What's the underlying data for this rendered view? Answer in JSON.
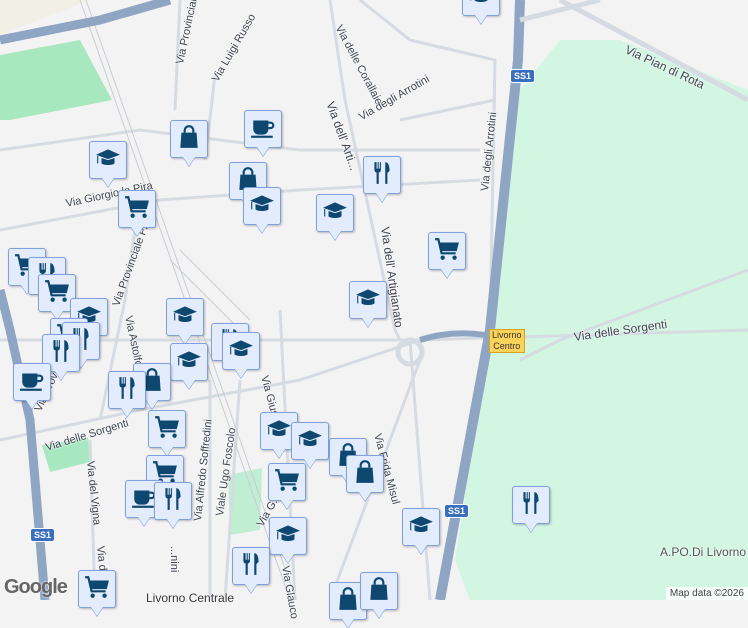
{
  "streets": {
    "provinciale_top": "Via Provinciale",
    "luigi_russo": "Via Luigi Russo",
    "corallaie": "Via delle Corallaie",
    "arrotini": "Via degli Arrotini",
    "arrotini2": "Via degli Arrotini",
    "artigianato_top": "Via dell' Arti...",
    "artigianato": "Via dell' Artigianato",
    "giorgio_la_pira": "Via Giorgio la Pira",
    "provinciale_pisana": "Via Provinciale P...",
    "astolfo": "Via Astolfo L...",
    "provinciale_left": "Via Provi...",
    "sorgenti_left": "Via delle Sorgenti",
    "sorgenti_right": "Via delle Sorgenti",
    "vigna": "Via del Vigna",
    "vigna2": "Via de...",
    "soffredini": "Via Alfredo Soffredini",
    "soffredini2": "...nini",
    "foscolo": "Viale Ugo Foscolo",
    "giuseppe": "Via Giuse...",
    "frida": "Via Frida Misul",
    "pian_di_rota": "Via Pian di Rota",
    "glauco": "Via Glauco",
    "via_g": "Via G...",
    "apo": "A.PO.Di Livorno"
  },
  "shields": {
    "ss1_top": "SS1",
    "ss1_mid": "SS1",
    "ss1_left": "SS1"
  },
  "exit_sign": [
    "Livorno",
    "Centro"
  ],
  "station": "Livorno Centrale",
  "google_logo": "Google",
  "attribution": "Map data ©2026",
  "colors": {
    "marker_bg": "#e3ecfc",
    "marker_icon": "#0e4870",
    "park": "#d3f6e3",
    "highway": "#8ea6c4"
  },
  "marker_types": [
    "shop",
    "cafe",
    "education",
    "restaurant",
    "grocery-cart"
  ]
}
